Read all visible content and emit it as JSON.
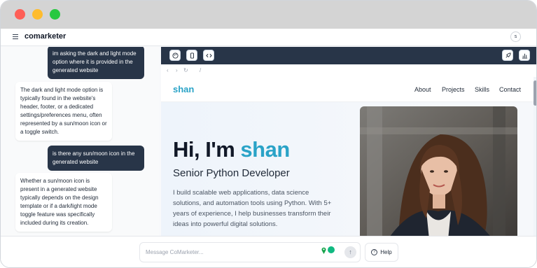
{
  "app": {
    "title": "comarketer",
    "avatar_letter": "s"
  },
  "chat": {
    "messages": [
      {
        "role": "user",
        "text": "im asking the dark and light mode option where it is provided in the generated website"
      },
      {
        "role": "assistant",
        "text": "The dark and light mode option is typically found in the website's header, footer, or a dedicated settings/preferences menu, often represented by a sun/moon icon or a toggle switch."
      },
      {
        "role": "user",
        "text": "is there any sun/moon icon in the generated website"
      },
      {
        "role": "assistant",
        "text": "Whether a sun/moon icon is present in a generated website typically depends on the design template or if a dark/light mode toggle feature was specifically included during its creation."
      }
    ]
  },
  "preview": {
    "url": "/",
    "toolbar_icons": [
      "palette-icon",
      "mobile-icon",
      "code-icon",
      "rocket-icon",
      "chart-icon"
    ],
    "site": {
      "logo": "shan",
      "nav": [
        "About",
        "Projects",
        "Skills",
        "Contact"
      ],
      "hero_greeting": "Hi, I'm",
      "hero_name": "shan",
      "hero_subtitle": "Senior Python Developer",
      "hero_paragraph": "I build scalable web applications, data science solutions, and automation tools using Python. With 5+ years of experience, I help businesses transform their ideas into powerful digital solutions."
    }
  },
  "composer": {
    "placeholder": "Message CoMarketer...",
    "help_label": "Help"
  },
  "colors": {
    "accent": "#2aa3c7",
    "dark_panel": "#283548",
    "titlebar": "#d4d4d4"
  }
}
